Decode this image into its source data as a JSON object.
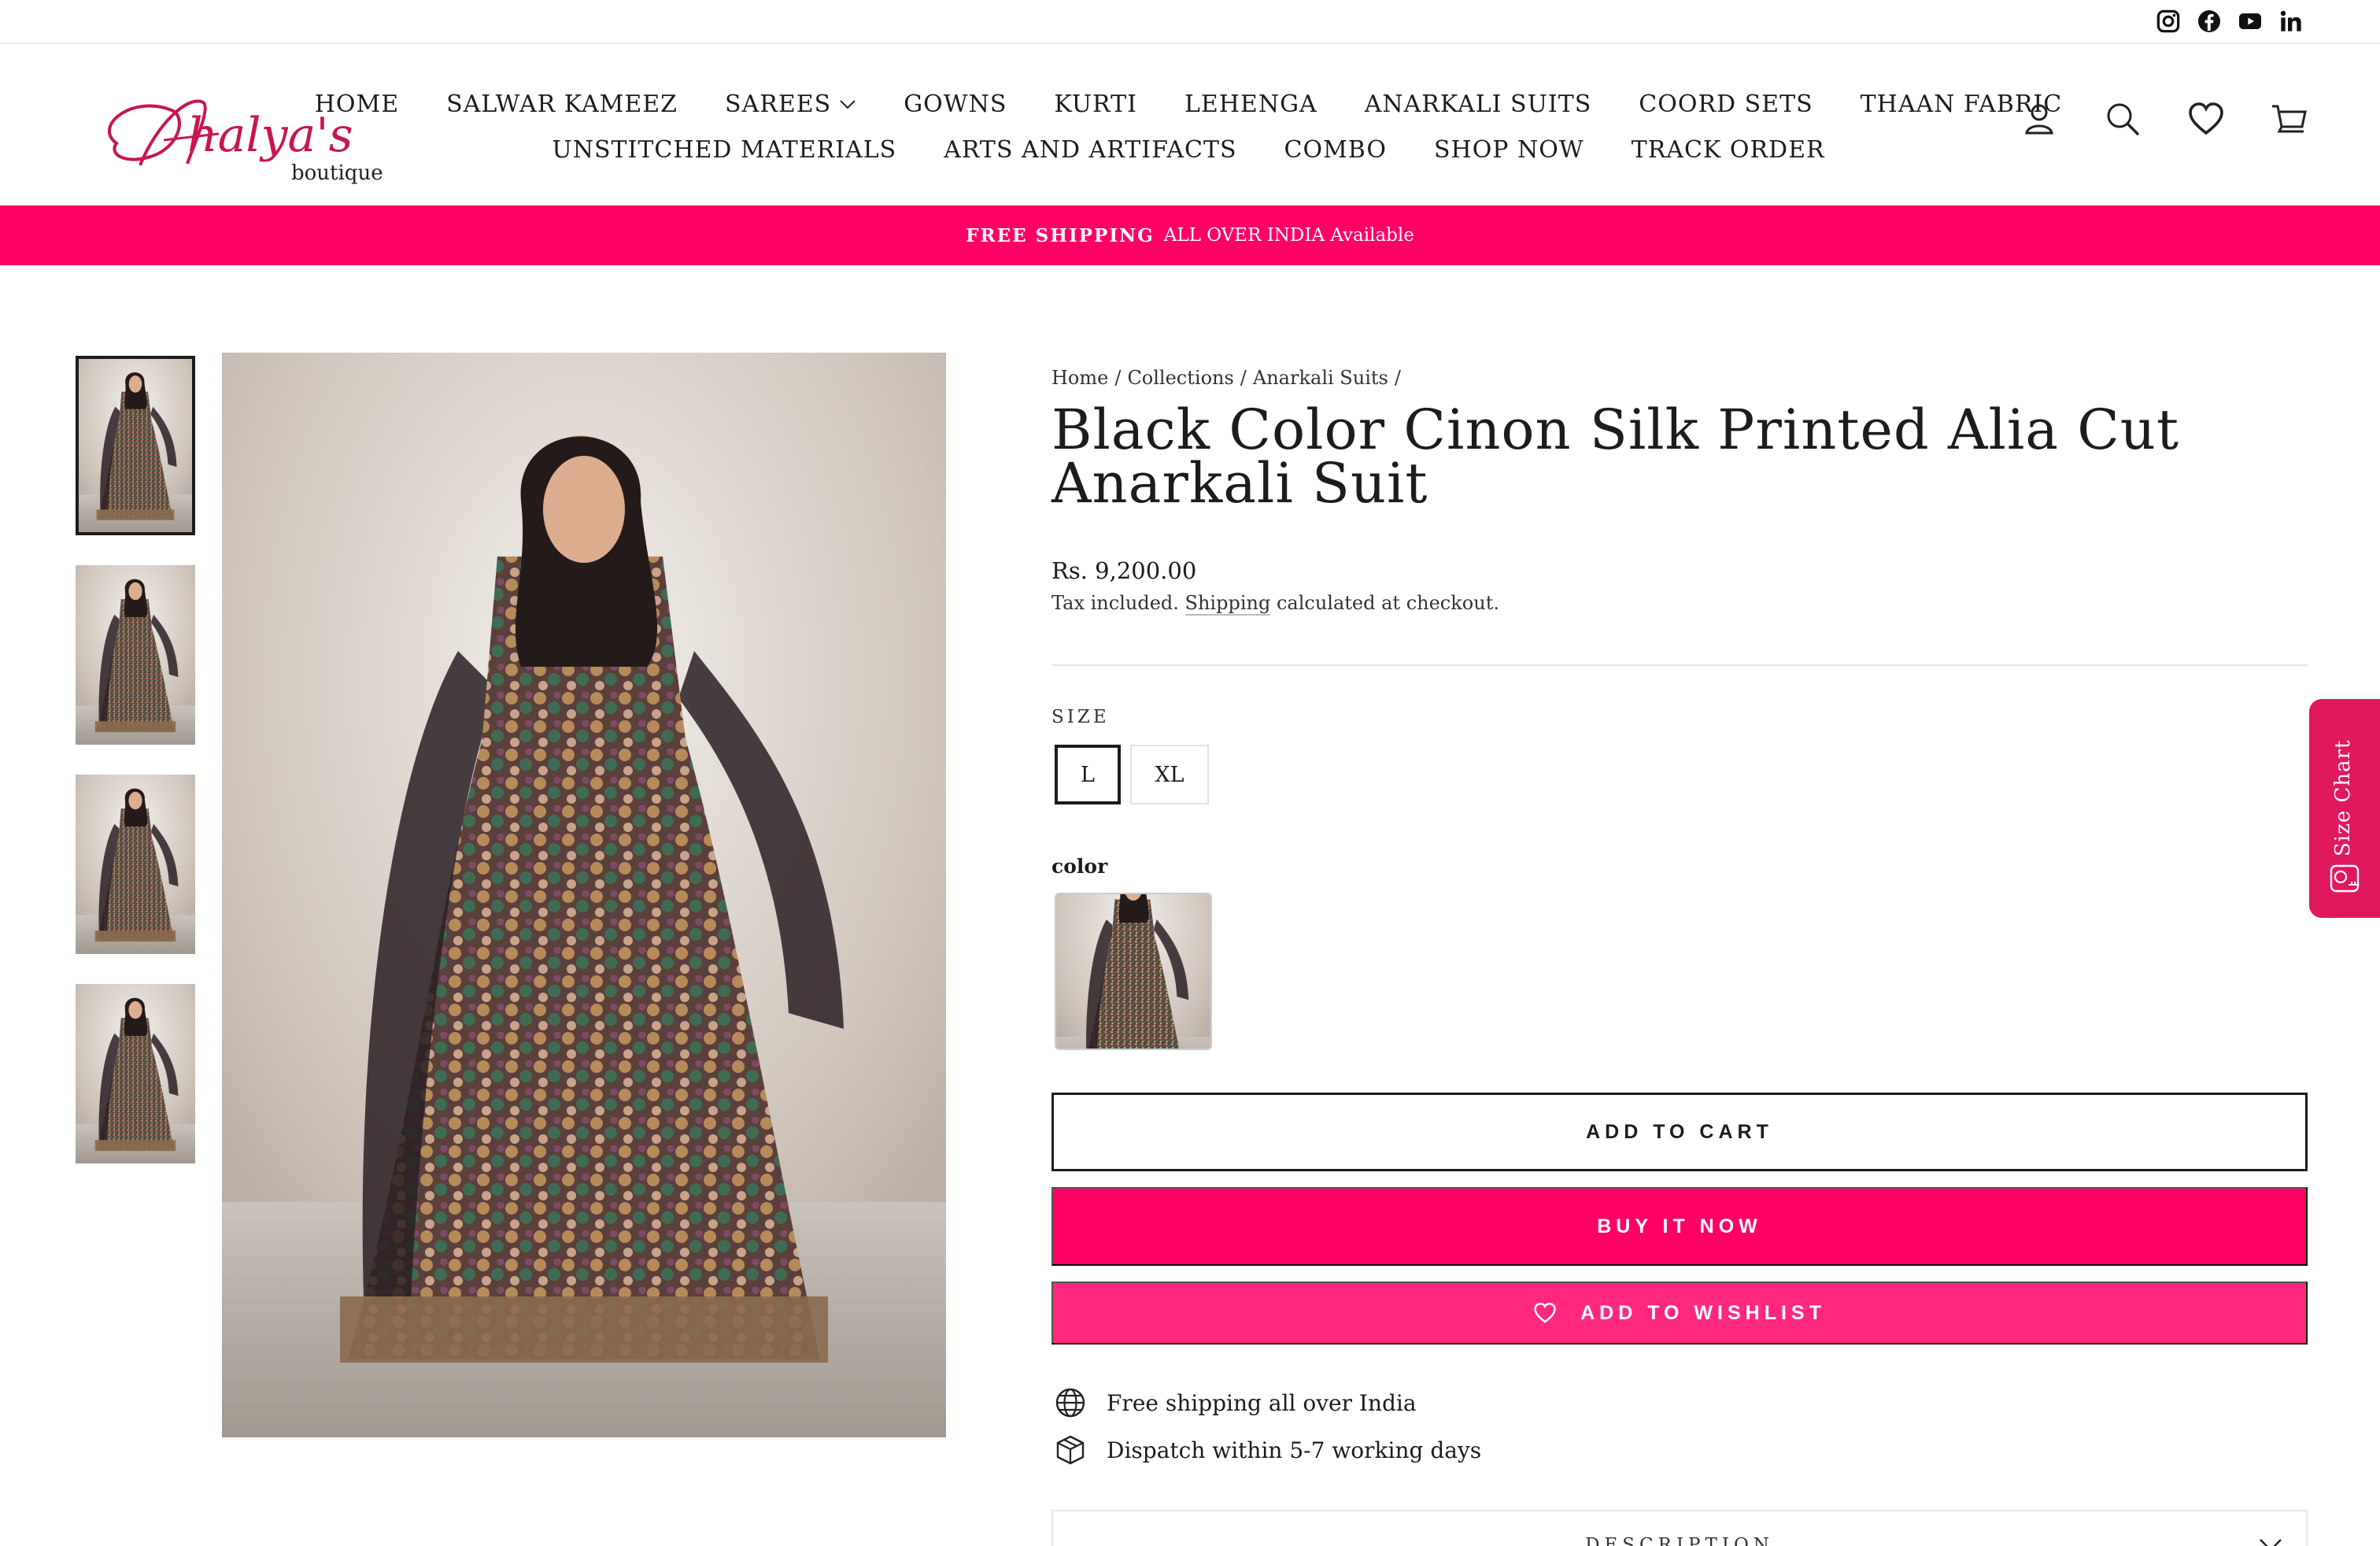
{
  "topbar": {
    "social": [
      "instagram",
      "facebook",
      "youtube",
      "linkedin"
    ]
  },
  "brand": {
    "logo_script": "Ahalya's",
    "logo_sub": "boutique",
    "accent": "#ff0066"
  },
  "nav": {
    "row1": [
      "HOME",
      "SALWAR KAMEEZ",
      "SAREES",
      "GOWNS",
      "KURTI",
      "LEHENGA",
      "ANARKALI SUITS",
      "COORD SETS",
      "THAAN FABRIC"
    ],
    "row2": [
      "UNSTITCHED MATERIALS",
      "ARTS AND ARTIFACTS",
      "COMBO",
      "SHOP NOW",
      "TRACK ORDER"
    ]
  },
  "header_icons": [
    "account-icon",
    "search-icon",
    "wishlist-heart-icon",
    "cart-icon"
  ],
  "announcement": {
    "strong": "FREE SHIPPING",
    "text": "ALL OVER INDIA Available"
  },
  "breadcrumb": [
    "Home",
    "/",
    "Collections",
    "/",
    "Anarkali Suits",
    "/"
  ],
  "product": {
    "title": "Black Color Cinon Silk Printed Alia Cut Anarkali Suit",
    "price": "Rs. 9,200.00",
    "tax_before": "Tax included.",
    "tax_link": "Shipping",
    "tax_after": "calculated at checkout.",
    "size_label": "SIZE",
    "sizes": [
      "L",
      "XL"
    ],
    "selected_size": "L",
    "color_label": "color"
  },
  "buttons": {
    "add_to_cart": "ADD TO CART",
    "buy_now": "BUY IT NOW",
    "add_to_wishlist": "ADD TO WISHLIST"
  },
  "features": {
    "shipping": "Free shipping all over India",
    "dispatch": "Dispatch within 5-7 working days"
  },
  "description": {
    "label": "DESCRIPTION"
  },
  "size_chart_tab": {
    "label": "Size Chart"
  }
}
